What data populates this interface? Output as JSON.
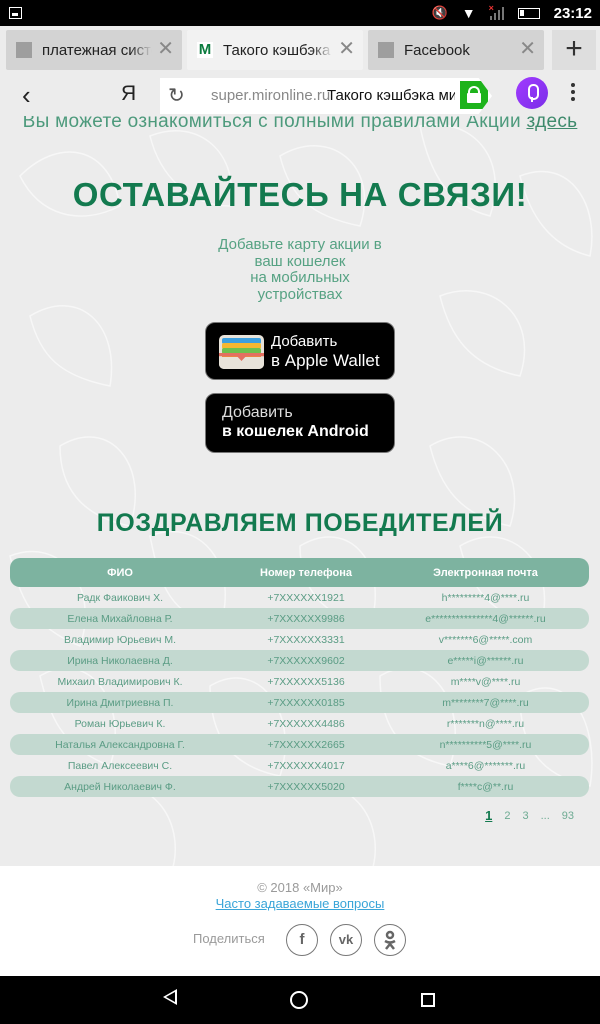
{
  "status_bar": {
    "time": "23:12",
    "icons": [
      "gallery-notification-icon",
      "mute-icon",
      "wifi-icon",
      "no-signal-icon",
      "battery-icon"
    ]
  },
  "tabs": [
    {
      "title": "платежная система Мир",
      "favicon": "generic",
      "active": false
    },
    {
      "title": "Такого кэшбэка мир",
      "favicon": "M",
      "active": true
    },
    {
      "title": "Facebook",
      "favicon": "generic",
      "active": false
    }
  ],
  "tab_close_glyph": "✕",
  "new_tab_glyph": "+",
  "address_bar": {
    "back_glyph": "‹",
    "yandex_glyph": "Я",
    "reload_glyph": "↻",
    "host": "super.mironline.ru",
    "page_title": "Такого кэшбэка мир"
  },
  "page": {
    "rules_text": "Вы можете ознакомиться с полными правилами Акции ",
    "rules_link": "здесь",
    "stay_heading": "ОСТАВАЙТЕСЬ НА СВЯЗИ!",
    "subtitle_lines": [
      "Добавьте карту акции в",
      "ваш кошелек",
      "на мобильных",
      "устройствах"
    ],
    "apple_wallet": {
      "line1": "Добавить",
      "line2": "в Apple Wallet"
    },
    "android_wallet": {
      "line1": "Добавить",
      "line2": "в кошелек Android"
    },
    "winners_heading": "ПОЗДРАВЛЯЕМ ПОБЕДИТЕЛЕЙ",
    "table": {
      "headers": [
        "ФИО",
        "Номер телефона",
        "Электронная почта"
      ],
      "rows": [
        [
          "Радк Фаикович Х.",
          "+7XXXXXX1921",
          "h*********4@****.ru"
        ],
        [
          "Елена Михайловна Р.",
          "+7XXXXXX9986",
          "e***************4@******.ru"
        ],
        [
          "Владимир Юрьевич М.",
          "+7XXXXXX3331",
          "v*******6@*****.com"
        ],
        [
          "Ирина Николаевна Д.",
          "+7XXXXXX9602",
          "e*****i@******.ru"
        ],
        [
          "Михаил Владимирович К.",
          "+7XXXXXX5136",
          "m****v@****.ru"
        ],
        [
          "Ирина Дмитриевна П.",
          "+7XXXXXX0185",
          "m********7@****.ru"
        ],
        [
          "Роман Юрьевич К.",
          "+7XXXXXX4486",
          "r*******n@****.ru"
        ],
        [
          "Наталья Александровна Г.",
          "+7XXXXXX2665",
          "n**********5@****.ru"
        ],
        [
          "Павел Алексеевич С.",
          "+7XXXXXX4017",
          "a****6@*******.ru"
        ],
        [
          "Андрей Николаевич Ф.",
          "+7XXXXXX5020",
          "f****c@**.ru"
        ]
      ]
    },
    "pagination": {
      "current": "1",
      "pages": [
        "2",
        "3"
      ],
      "ellipsis": "...",
      "last": "93"
    }
  },
  "footer": {
    "copyright": "© 2018 «Мир»",
    "faq_link": "Часто задаваемые вопросы",
    "share_label": "Поделиться",
    "social": [
      {
        "name": "facebook",
        "glyph": "f"
      },
      {
        "name": "vkontakte",
        "glyph": "vk"
      },
      {
        "name": "odnoklassniki",
        "glyph": "ok"
      }
    ]
  },
  "colors": {
    "brand_green": "#137a4f",
    "table_header": "#7db3a0",
    "table_alt_row": "#c3d9d0",
    "link_blue": "#3aa5d8",
    "secure_lock": "#1db31b",
    "alice_mic": "#8c33f0"
  }
}
